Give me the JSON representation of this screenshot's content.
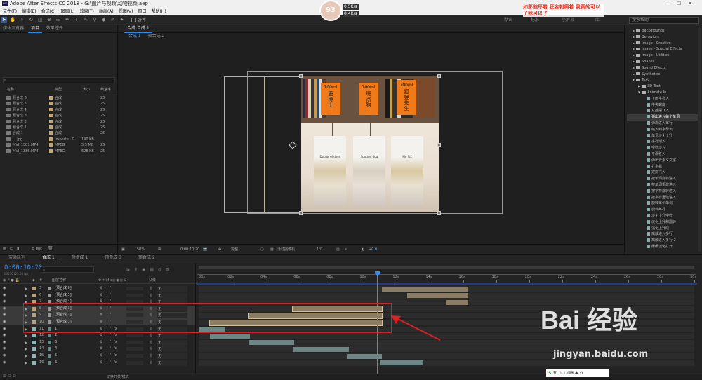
{
  "titlebar": {
    "title": "Adobe After Effects CC 2018 - G:\\图片与视频\\动物视频.aep",
    "icon": "Ae",
    "controls": "–☐✕"
  },
  "menu": [
    "文件(F)",
    "编辑(E)",
    "合成(C)",
    "图层(L)",
    "效果(T)",
    "动画(A)",
    "视图(V)",
    "窗口",
    "帮助(H)"
  ],
  "toolbar": {
    "snap_label": "对齐",
    "workspaces": [
      "默认",
      "标准",
      "小屏幕",
      "库"
    ],
    "search_placeholder": "搜索帮助"
  },
  "overlay": {
    "badge": "93",
    "speed_up": "0.5K/s",
    "speed_down": "0.4K/s",
    "caption": "如影随形着 狂妄刺痛着 我真的可以了我可以了"
  },
  "project": {
    "tabs": [
      "媒体浏览器",
      "项目",
      "效果控件"
    ],
    "columns": [
      "名称",
      "类型",
      "大小",
      "帧速率"
    ],
    "rows": [
      {
        "name": "预合成 6",
        "type": "合成",
        "size": "",
        "fps": "25"
      },
      {
        "name": "预合成 5",
        "type": "合成",
        "size": "",
        "fps": "25"
      },
      {
        "name": "预合成 4",
        "type": "合成",
        "size": "",
        "fps": "25"
      },
      {
        "name": "预合成 3",
        "type": "合成",
        "size": "",
        "fps": "25"
      },
      {
        "name": "预合成 2",
        "type": "合成",
        "size": "",
        "fps": "25"
      },
      {
        "name": "预合成 1",
        "type": "合成",
        "size": "",
        "fps": "25"
      },
      {
        "name": "合成 1",
        "type": "合成",
        "size": "",
        "fps": "25"
      },
      {
        "name": "....jpg",
        "type": "Importe...G",
        "size": "140 KB",
        "fps": ""
      },
      {
        "name": "MVI_1387.MP4",
        "type": "MPEG",
        "size": "5.5 MB",
        "fps": "25"
      },
      {
        "name": "MVI_1386.MP4",
        "type": "MPEG",
        "size": "628 KB",
        "fps": "25"
      }
    ],
    "bpc": "8 bpc"
  },
  "comp": {
    "tab_label": "合成 合成 1",
    "sub_tabs": [
      "合成 1",
      "预合成 2"
    ],
    "signs": [
      {
        "size": "700ml",
        "name": "鹿博士"
      },
      {
        "size": "700ml",
        "name": "斑点狗"
      },
      {
        "size": "700ml",
        "name": "狐狸先生"
      }
    ],
    "cup_labels": [
      "Doctor of deer",
      "Spotted dog",
      "Mr. fox"
    ],
    "footer": {
      "zoom": "50%",
      "time": "0:00:10:20",
      "quality": "完整",
      "camera": "活动摄像机",
      "views": "1个...",
      "exposure": "+0.0"
    }
  },
  "effects": {
    "items": [
      {
        "t": "Backgrounds",
        "k": "f",
        "d": 1
      },
      {
        "t": "Behaviors",
        "k": "f",
        "d": 1
      },
      {
        "t": "Image - Creative",
        "k": "f",
        "d": 1
      },
      {
        "t": "Image - Special Effects",
        "k": "f",
        "d": 1
      },
      {
        "t": "Image - Utilities",
        "k": "f",
        "d": 1
      },
      {
        "t": "Shapes",
        "k": "f",
        "d": 1
      },
      {
        "t": "Sound Effects",
        "k": "f",
        "d": 1
      },
      {
        "t": "Synthetics",
        "k": "f",
        "d": 1
      },
      {
        "t": "Text",
        "k": "f",
        "d": 1
      },
      {
        "t": "3D Text",
        "k": "f",
        "d": 2
      },
      {
        "t": "Animate In",
        "k": "f",
        "d": 2
      },
      {
        "t": "下雨字符入",
        "k": "p",
        "d": 3
      },
      {
        "t": "中央螺旋",
        "k": "p",
        "d": 3
      },
      {
        "t": "从摇摆飞入",
        "k": "p",
        "d": 3
      },
      {
        "t": "弹出进入每个单词",
        "k": "p",
        "d": 3,
        "sel": true
      },
      {
        "t": "弹跳进入每行",
        "k": "p",
        "d": 3
      },
      {
        "t": "缩入到字母表",
        "k": "p",
        "d": 3
      },
      {
        "t": "单词淡化上升",
        "k": "p",
        "d": 3
      },
      {
        "t": "字符渐入",
        "k": "p",
        "d": 3
      },
      {
        "t": "字符淡入",
        "k": "p",
        "d": 3
      },
      {
        "t": "平滑移入",
        "k": "p",
        "d": 3
      },
      {
        "t": "弹出元素义文字",
        "k": "p",
        "d": 3
      },
      {
        "t": "打字机",
        "k": "p",
        "d": 3
      },
      {
        "t": "拨拼飞入",
        "k": "p",
        "d": 3
      },
      {
        "t": "按单词旋转进入",
        "k": "p",
        "d": 3
      },
      {
        "t": "按单词重建进入",
        "k": "p",
        "d": 3
      },
      {
        "t": "按字符旋转进入",
        "k": "p",
        "d": 3
      },
      {
        "t": "按字符重建进入",
        "k": "p",
        "d": 3
      },
      {
        "t": "旋转每个单词",
        "k": "p",
        "d": 3
      },
      {
        "t": "旋转每行",
        "k": "p",
        "d": 3
      },
      {
        "t": "淡化上升字符",
        "k": "p",
        "d": 3
      },
      {
        "t": "淡化上升和翻转",
        "k": "p",
        "d": 3
      },
      {
        "t": "淡化上升线",
        "k": "p",
        "d": 3
      },
      {
        "t": "离散进入多行",
        "k": "p",
        "d": 3
      },
      {
        "t": "离散进入多行 2",
        "k": "p",
        "d": 3
      },
      {
        "t": "缓缓淡化打开",
        "k": "p",
        "d": 3
      }
    ]
  },
  "timeline": {
    "tabs": [
      "渲染队列",
      "合成 1",
      "预合成 1",
      "预合成 3",
      "预合成 2"
    ],
    "timecode": "0:00:10:20",
    "frames": "00270 (25.00 fps)",
    "col_layer": "图层名称",
    "col_parent": "父级",
    "ticks": [
      "00s",
      "02s",
      "04s",
      "06s",
      "08s",
      "10s",
      "12s",
      "14s",
      "16s",
      "18s",
      "20s",
      "22s",
      "24s",
      "26s",
      "28s",
      "30s"
    ],
    "layers": [
      {
        "num": "5",
        "name": "[预合成 6]",
        "parent": "无",
        "color": "#b8a27a",
        "pre": true,
        "start": 11.1,
        "end": 16.3
      },
      {
        "num": "6",
        "name": "[预合成 5]",
        "parent": "无",
        "color": "#b8a27a",
        "pre": true,
        "start": 12.6,
        "end": 16.3
      },
      {
        "num": "7",
        "name": "[预合成 4]",
        "parent": "无",
        "color": "#b8a27a",
        "pre": true,
        "start": 15,
        "end": 16.3
      },
      {
        "num": "8",
        "name": "[预合成 3]",
        "parent": "无",
        "color": "#b8a27a",
        "pre": true,
        "start": 5.7,
        "end": 11.1,
        "hl": true
      },
      {
        "num": "9",
        "name": "[预合成 2]",
        "parent": "无",
        "color": "#b8a27a",
        "pre": true,
        "start": 3,
        "end": 11.1,
        "hl": true
      },
      {
        "num": "10",
        "name": "[预合成 1]",
        "parent": "无",
        "color": "#b8a27a",
        "pre": true,
        "start": 0.7,
        "end": 11.1,
        "hl": true
      },
      {
        "num": "11",
        "name": "1",
        "parent": "无",
        "color": "#8ab8b8",
        "pre": false,
        "start": 0,
        "end": 1.6
      },
      {
        "num": "12",
        "name": "2",
        "parent": "无",
        "color": "#8ab8b8",
        "pre": false,
        "start": 0.7,
        "end": 3.1
      },
      {
        "num": "13",
        "name": "3",
        "parent": "无",
        "color": "#8ab8b8",
        "pre": false,
        "start": 3,
        "end": 5.8
      },
      {
        "num": "14",
        "name": "4",
        "parent": "无",
        "color": "#8ab8b8",
        "pre": false,
        "start": 5.7,
        "end": 9.1
      },
      {
        "num": "15",
        "name": "5",
        "parent": "无",
        "color": "#8ab8b8",
        "pre": false,
        "start": 9,
        "end": 11.1
      },
      {
        "num": "16",
        "name": "6",
        "parent": "无",
        "color": "#8ab8b8",
        "pre": false,
        "start": 11,
        "end": 13.6
      }
    ],
    "footer": "切换开关/模式",
    "playhead_sec": 10.8
  },
  "watermark": {
    "brand": "Bai 经验",
    "url": "jingyan.baidu.com"
  }
}
